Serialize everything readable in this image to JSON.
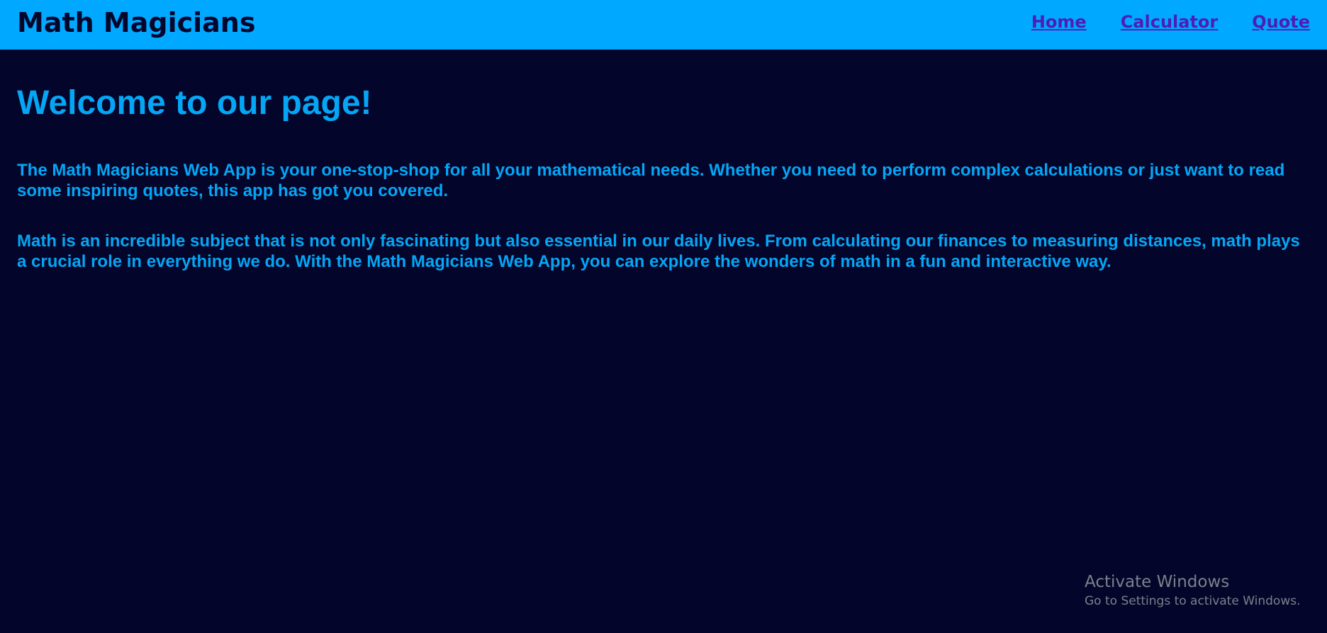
{
  "header": {
    "brand": "Math Magicians",
    "nav": {
      "home": "Home",
      "calculator": "Calculator",
      "quote": "Quote"
    }
  },
  "main": {
    "heading": "Welcome to our page!",
    "paragraphs": [
      "The Math Magicians Web App is your one-stop-shop for all your mathematical needs. Whether you need to perform complex calculations or just want to read some inspiring quotes, this app has got you covered.",
      "Math is an incredible subject that is not only fascinating but also essential in our daily lives. From calculating our finances to measuring distances, math plays a crucial role in everything we do. With the Math Magicians Web App, you can explore the wonders of math in a fun and interactive way."
    ]
  },
  "watermark": {
    "title": "Activate Windows",
    "subtitle": "Go to Settings to activate Windows."
  },
  "colors": {
    "background": "#04052a",
    "navbar": "#00a8ff",
    "text_accent": "#04a6f5",
    "link": "#4d1db6"
  }
}
